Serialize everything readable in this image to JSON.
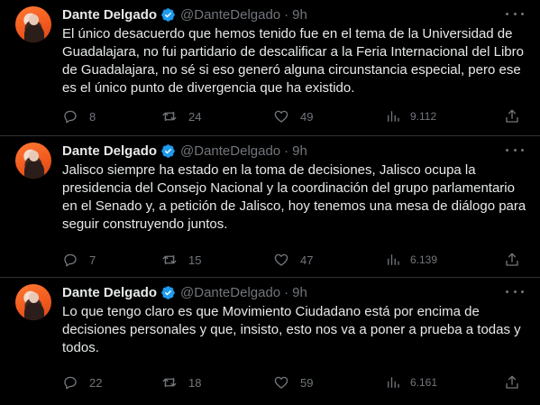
{
  "author": {
    "name": "Dante Delgado",
    "handle": "@DanteDelgado",
    "separator": "·"
  },
  "colors": {
    "background": "#000000",
    "text": "#e7e9ea",
    "muted": "#71767b",
    "verified": "#1d9bf0",
    "divider": "#2f3336"
  },
  "icons": [
    "verified-badge-icon",
    "more-icon",
    "reply-icon",
    "retweet-icon",
    "like-icon",
    "views-icon",
    "share-icon"
  ],
  "tweets": [
    {
      "time": "9h",
      "text": "El único desacuerdo que hemos tenido fue en el tema de la Universidad de Guadalajara, no fui partidario de descalificar a la Feria Internacional del Libro de Guadalajara, no sé si eso generó alguna circunstancia especial, pero ese es el único punto de divergencia que ha existido.",
      "replies": "8",
      "retweets": "24",
      "likes": "49",
      "views": "9.112"
    },
    {
      "time": "9h",
      "text": "Jalisco siempre ha estado en la toma de decisiones, Jalisco ocupa la presidencia del Consejo Nacional y la coordinación del grupo parlamentario en el Senado y, a petición de Jalisco, hoy tenemos una mesa de diálogo para seguir construyendo juntos.",
      "replies": "7",
      "retweets": "15",
      "likes": "47",
      "views": "6.139"
    },
    {
      "time": "9h",
      "text": "Lo que tengo claro es que Movimiento Ciudadano está por encima de decisiones personales y que, insisto, esto nos va a poner a prueba a todas y todos.",
      "replies": "22",
      "retweets": "18",
      "likes": "59",
      "views": "6.161"
    }
  ]
}
